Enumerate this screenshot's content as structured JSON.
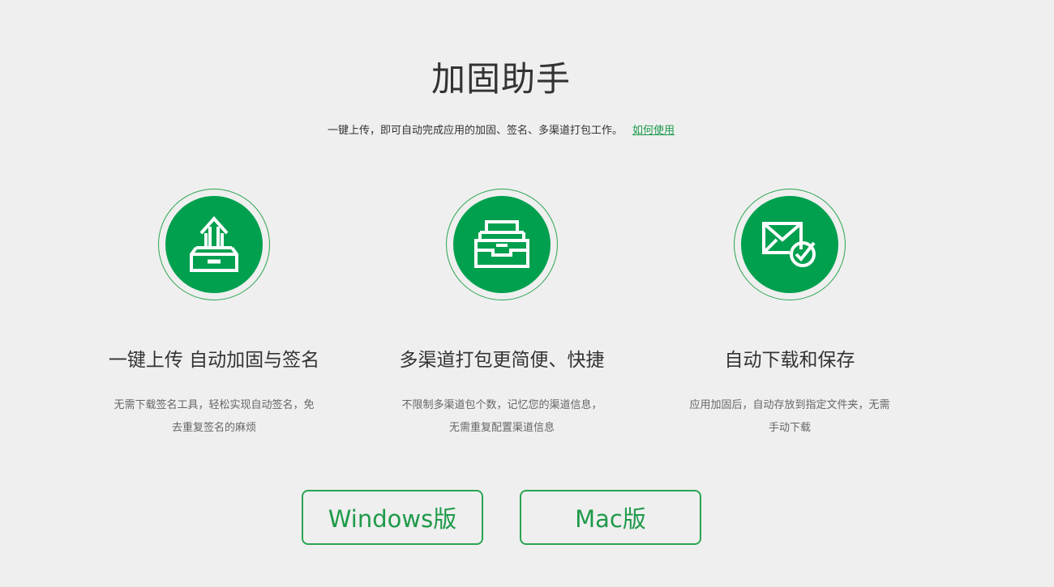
{
  "header": {
    "title": "加固助手",
    "subtitle": "一键上传，即可自动完成应用的加固、签名、多渠道打包工作。",
    "how_to_link": "如何使用"
  },
  "features": [
    {
      "icon": "upload-tray-icon",
      "title": "一键上传 自动加固与签名",
      "desc_line1": "无需下载签名工具，轻松实现自动签名，免",
      "desc_line2": "去重复签名的麻烦"
    },
    {
      "icon": "inbox-package-icon",
      "title": "多渠道打包更简便、快捷",
      "desc_line1": "不限制多渠道包个数，记忆您的渠道信息，",
      "desc_line2": "无需重复配置渠道信息"
    },
    {
      "icon": "mail-check-icon",
      "title": "自动下载和保存",
      "desc_line1": "应用加固后，自动存放到指定文件夹，无需",
      "desc_line2": "手动下载"
    }
  ],
  "downloads": {
    "windows_label": "Windows版",
    "mac_label": "Mac版"
  },
  "colors": {
    "accent": "#00a04f",
    "background": "#efefef",
    "text": "#333333"
  }
}
